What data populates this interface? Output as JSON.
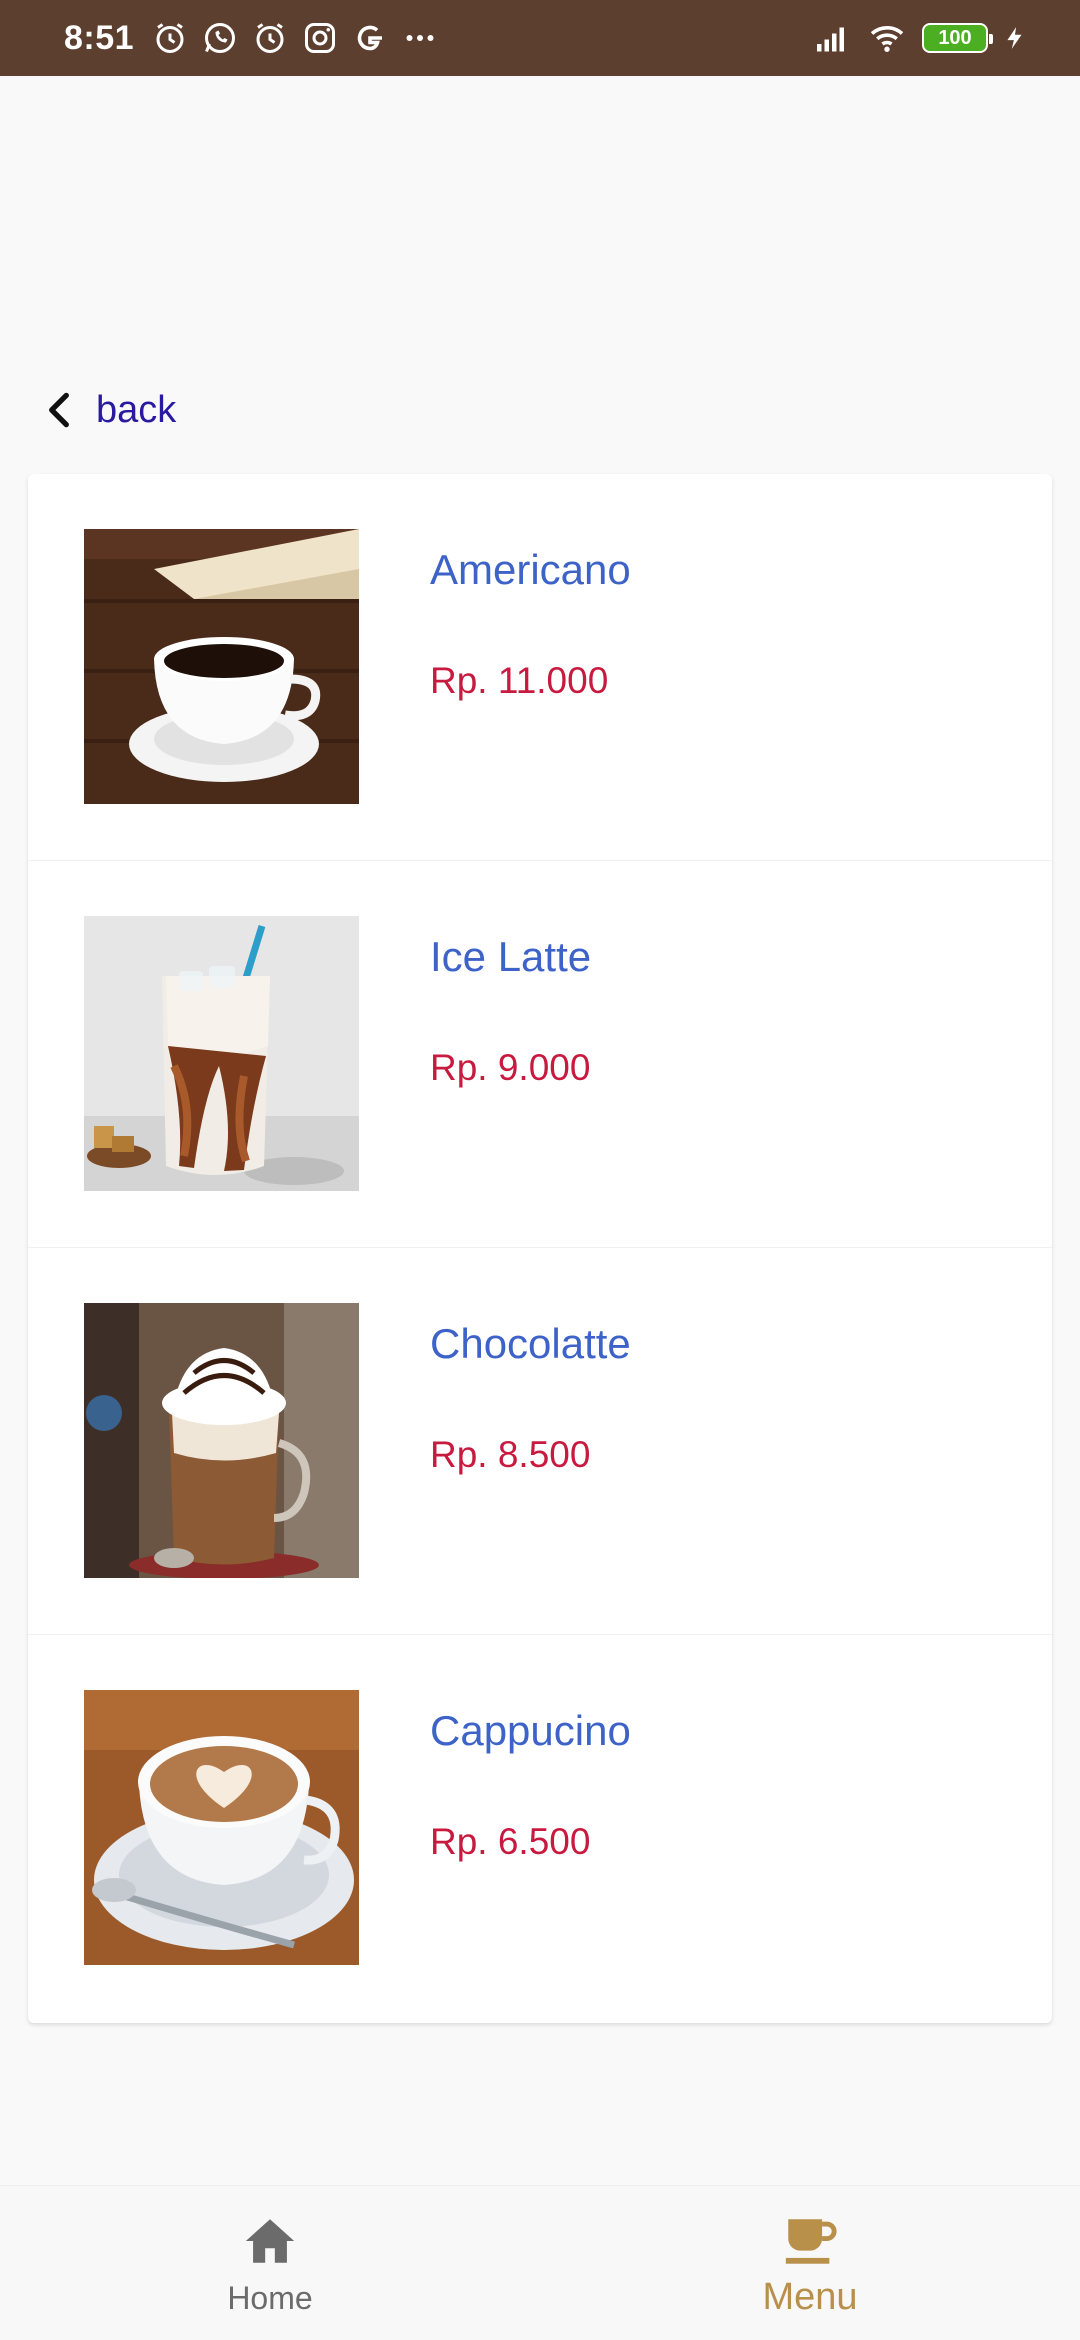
{
  "status_bar": {
    "time": "8:51",
    "battery": "100",
    "left_icons": [
      "alarm-icon",
      "whatsapp-icon",
      "alarm-icon",
      "instagram-icon",
      "google-icon",
      "more-icon"
    ],
    "right_icons": [
      "signal-icon",
      "wifi-icon",
      "battery-icon",
      "charging-icon"
    ]
  },
  "nav": {
    "back_label": "back"
  },
  "menu": {
    "items": [
      {
        "name": "Americano",
        "price": "Rp. 11.000"
      },
      {
        "name": "Ice Latte",
        "price": "Rp. 9.000"
      },
      {
        "name": "Chocolatte",
        "price": "Rp. 8.500"
      },
      {
        "name": "Cappucino",
        "price": "Rp. 6.500"
      }
    ]
  },
  "bottom_nav": {
    "home_label": "Home",
    "menu_label": "Menu",
    "active": "Menu"
  },
  "colors": {
    "status_bar": "#5d3f2f",
    "item_name": "#3d63c9",
    "item_price": "#c8193f",
    "back_text": "#2a1aa0",
    "nav_active": "#b8904a",
    "nav_inactive": "#6b6b6b"
  }
}
